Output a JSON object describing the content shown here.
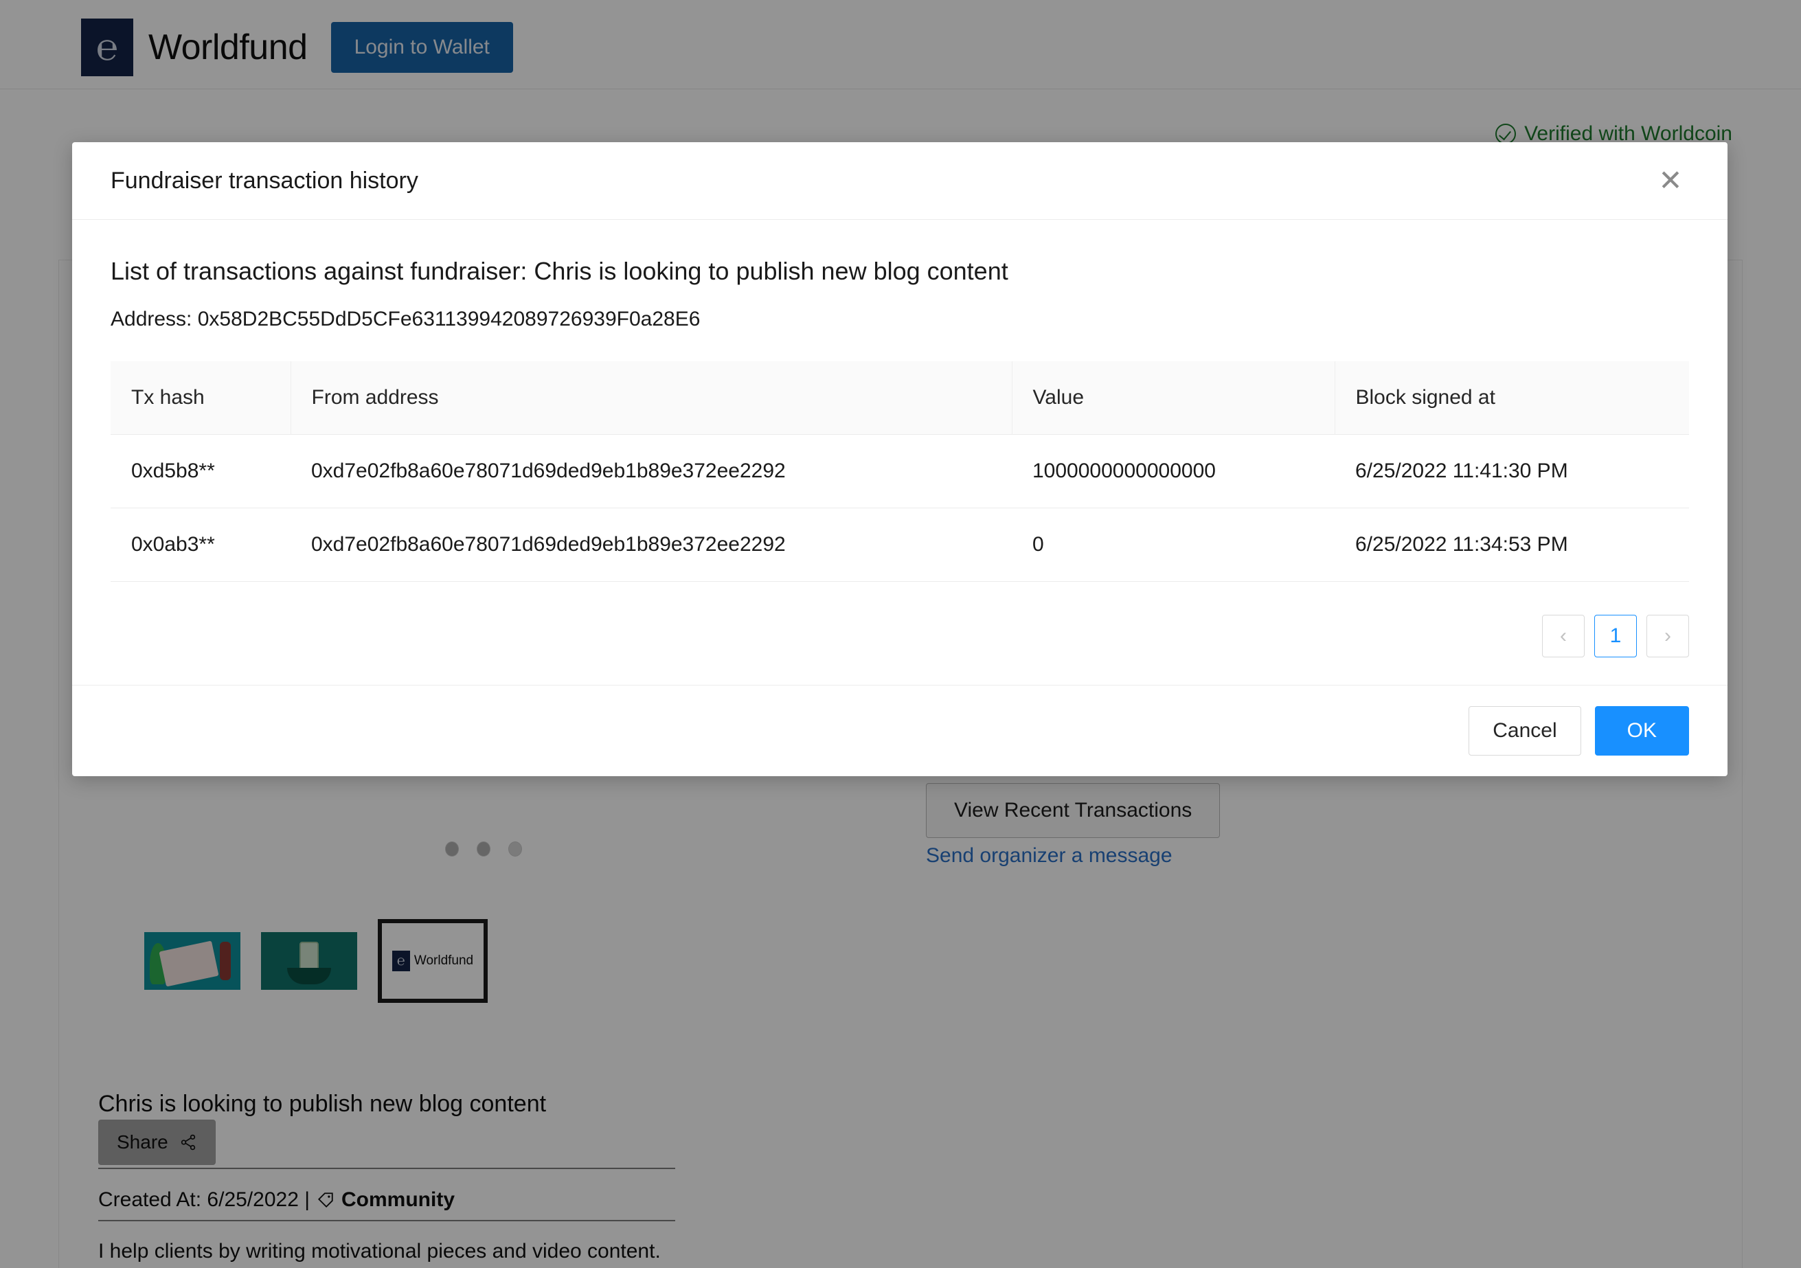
{
  "topbar": {
    "brand_name": "Worldfund",
    "logo_glyph": "℮",
    "login_label": "Login to Wallet"
  },
  "background": {
    "verified_text": "Verified with Worldcoin",
    "verified_color": "#1e7a2e",
    "view_transactions_label": "View Recent Transactions",
    "send_message_label": "Send organizer a message",
    "fundraiser_title": "Chris is looking to publish new blog content",
    "share_label": "Share",
    "created_at_text": "Created At: 6/25/2022 |",
    "category": "Community",
    "description": "I help clients by writing motivational pieces and video content.",
    "thumbnail_label": "Worldfund"
  },
  "modal": {
    "title": "Fundraiser transaction history",
    "close_glyph": "✕",
    "list_heading": "List of transactions against fundraiser: Chris is looking to publish new blog content",
    "address_line": "Address: 0x58D2BC55DdD5CFe631139942089726939F0a28E6",
    "columns": [
      "Tx hash",
      "From address",
      "Value",
      "Block signed at"
    ],
    "rows": [
      {
        "tx_hash": "0xd5b8**",
        "from_address": "0xd7e02fb8a60e78071d69ded9eb1b89e372ee2292",
        "value": "1000000000000000",
        "block_signed_at": "6/25/2022 11:41:30 PM"
      },
      {
        "tx_hash": "0x0ab3**",
        "from_address": "0xd7e02fb8a60e78071d69ded9eb1b89e372ee2292",
        "value": "0",
        "block_signed_at": "6/25/2022 11:34:53 PM"
      }
    ],
    "pagination": {
      "prev_glyph": "‹",
      "next_glyph": "›",
      "current_page": "1",
      "accent_color": "#1890ff"
    },
    "cancel_label": "Cancel",
    "ok_label": "OK"
  }
}
